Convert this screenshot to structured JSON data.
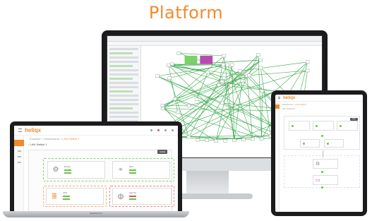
{
  "page": {
    "title": "Platform"
  },
  "brand": {
    "name": "heliqx",
    "accent": "#f08a2c"
  },
  "monitor": {
    "graph_colors": {
      "edge": "#3aa84b",
      "node": "#9aa0a6",
      "highlight_green": "#7bd06b",
      "highlight_purple": "#b64bb0"
    }
  },
  "laptop": {
    "brand_label": "MacBook Pro",
    "tab_label": "LAN Switch 1",
    "breadcrumb": {
      "prefix": "Example > Dashboards >",
      "current": "LAN Switch 1"
    },
    "save_label": "SAVE",
    "devices": [
      {
        "name": "Router",
        "lines": [
          "Status: online",
          "Ping: 4ms"
        ],
        "icon": "gear-icon"
      },
      {
        "name": "WLC",
        "lines": [
          "Status: online",
          "Ping: 6ms"
        ],
        "icon": "crosshair-icon"
      },
      {
        "name": "UPS",
        "lines": [
          "OK: 43 items",
          "Ping: 5ms"
        ],
        "icon": "layers-icon"
      },
      {
        "name": "Internet",
        "lines": [
          "Failure: 1 item",
          "Ping: -"
        ],
        "icon": "globe-icon"
      }
    ],
    "status_colors": {
      "ok": "#6cc04a",
      "warn": "#f08a2c",
      "error": "#d85555"
    }
  },
  "tablet": {
    "breadcrumb": {
      "prefix": "Dashboard >",
      "current": "LAN Switch"
    },
    "section_label": "Site Switches",
    "save_label": "SAVE"
  }
}
